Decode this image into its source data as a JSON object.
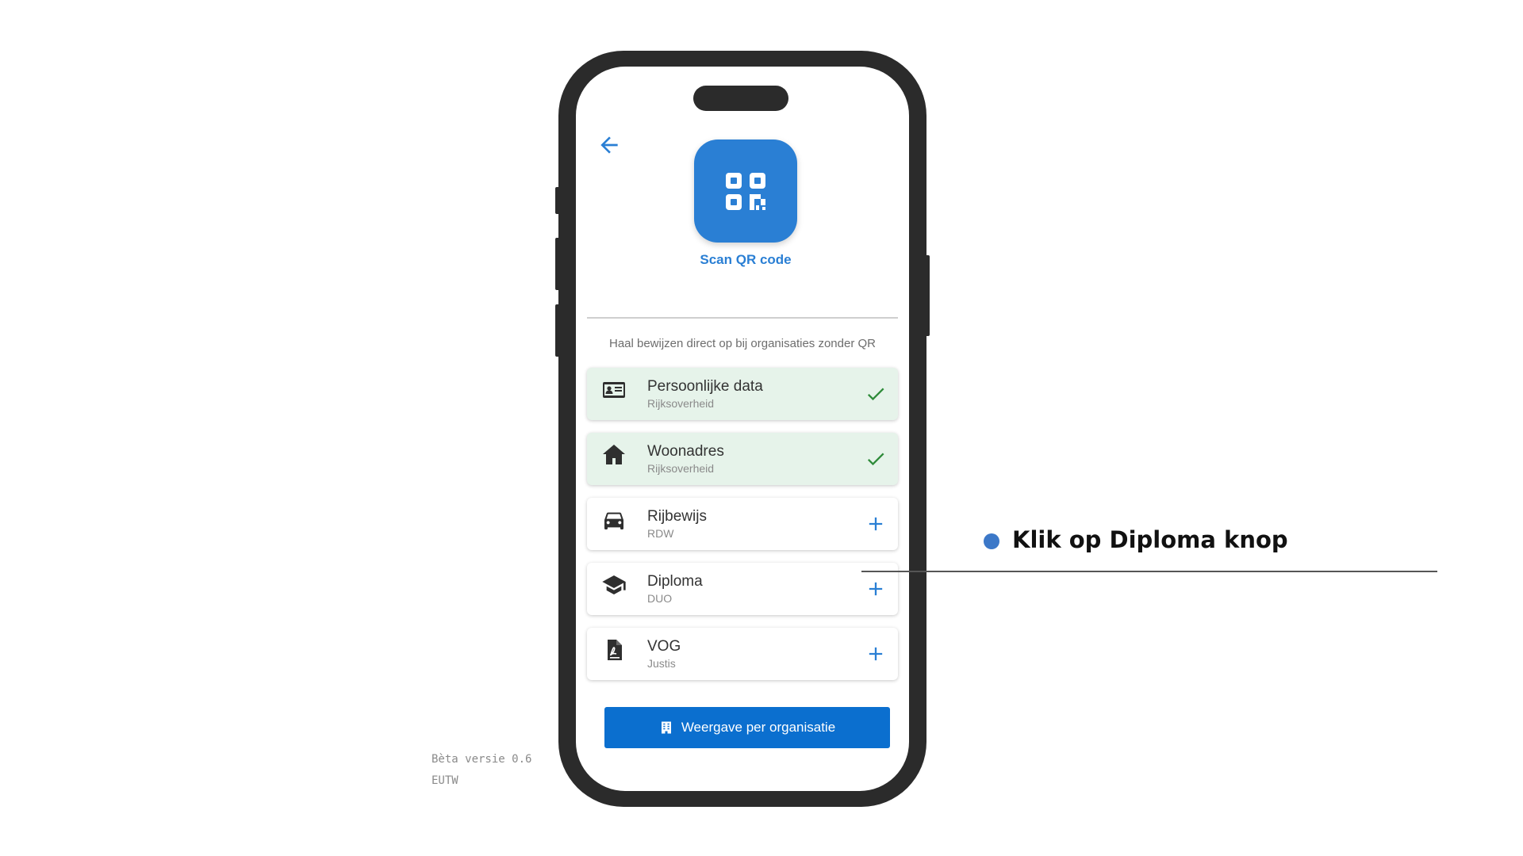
{
  "app": {
    "back_icon": "arrow-left-icon",
    "scan": {
      "icon": "qr-code-icon",
      "label": "Scan QR code"
    },
    "hint": "Haal bewijzen direct op bij organisaties zonder QR",
    "cards": [
      {
        "title": "Persoonlijke data",
        "subtitle": "Rijksoverheid",
        "icon": "id-card-icon",
        "state": "added"
      },
      {
        "title": "Woonadres",
        "subtitle": "Rijksoverheid",
        "icon": "house-icon",
        "state": "added"
      },
      {
        "title": "Rijbewijs",
        "subtitle": "RDW",
        "icon": "car-icon",
        "state": "add"
      },
      {
        "title": "Diploma",
        "subtitle": "DUO",
        "icon": "graduation-cap-icon",
        "state": "add"
      },
      {
        "title": "VOG",
        "subtitle": "Justis",
        "icon": "document-icon",
        "state": "add"
      }
    ],
    "primary_button": {
      "label": "Weergave per organisatie",
      "icon": "building-icon"
    }
  },
  "version": {
    "line1": "Bèta versie 0.6",
    "line2": "EUTW"
  },
  "callout": {
    "text": "Klik op Diploma knop"
  },
  "colors": {
    "accent": "#2a7fd4",
    "button": "#0b6fcf",
    "done_bg": "#e6f3ea",
    "check": "#2e8b3a",
    "callout_dot": "#3c78c8"
  }
}
